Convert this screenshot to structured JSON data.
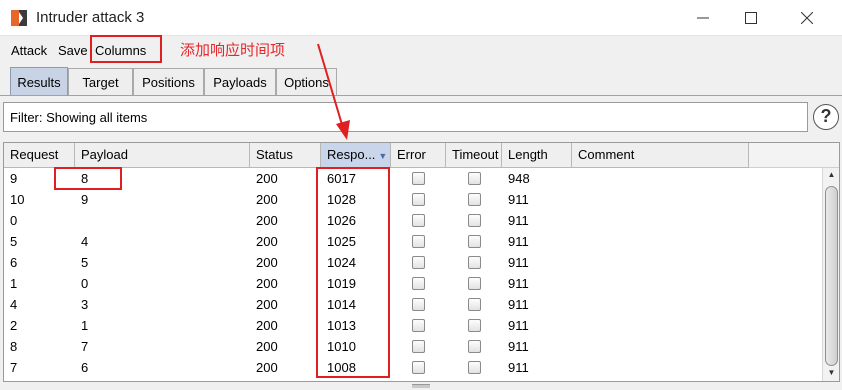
{
  "window": {
    "title": "Intruder attack 3"
  },
  "menu": {
    "attack": "Attack",
    "save": "Save",
    "columns": "Columns"
  },
  "annotation": {
    "note": "添加响应时间项",
    "color": "#e02020"
  },
  "tabs": [
    {
      "label": "Results",
      "active": true
    },
    {
      "label": "Target",
      "active": false
    },
    {
      "label": "Positions",
      "active": false
    },
    {
      "label": "Payloads",
      "active": false
    },
    {
      "label": "Options",
      "active": false
    }
  ],
  "filter": {
    "text": "Filter: Showing all items"
  },
  "table": {
    "columns": [
      "Request",
      "Payload",
      "Status",
      "Respo...",
      "Error",
      "Timeout",
      "Length",
      "Comment"
    ],
    "sorted_column": "Respo...",
    "rows": [
      {
        "request": "9",
        "payload": "8",
        "status": "200",
        "response": "6017",
        "error": false,
        "timeout": false,
        "length": "948",
        "comment": ""
      },
      {
        "request": "10",
        "payload": "9",
        "status": "200",
        "response": "1028",
        "error": false,
        "timeout": false,
        "length": "911",
        "comment": ""
      },
      {
        "request": "0",
        "payload": "",
        "status": "200",
        "response": "1026",
        "error": false,
        "timeout": false,
        "length": "911",
        "comment": ""
      },
      {
        "request": "5",
        "payload": "4",
        "status": "200",
        "response": "1025",
        "error": false,
        "timeout": false,
        "length": "911",
        "comment": ""
      },
      {
        "request": "6",
        "payload": "5",
        "status": "200",
        "response": "1024",
        "error": false,
        "timeout": false,
        "length": "911",
        "comment": ""
      },
      {
        "request": "1",
        "payload": "0",
        "status": "200",
        "response": "1019",
        "error": false,
        "timeout": false,
        "length": "911",
        "comment": ""
      },
      {
        "request": "4",
        "payload": "3",
        "status": "200",
        "response": "1014",
        "error": false,
        "timeout": false,
        "length": "911",
        "comment": ""
      },
      {
        "request": "2",
        "payload": "1",
        "status": "200",
        "response": "1013",
        "error": false,
        "timeout": false,
        "length": "911",
        "comment": ""
      },
      {
        "request": "8",
        "payload": "7",
        "status": "200",
        "response": "1010",
        "error": false,
        "timeout": false,
        "length": "911",
        "comment": ""
      },
      {
        "request": "7",
        "payload": "6",
        "status": "200",
        "response": "1008",
        "error": false,
        "timeout": false,
        "length": "911",
        "comment": ""
      }
    ]
  },
  "icons": {
    "app": "burp-logo-icon",
    "help": "help-icon",
    "minimize": "minimize-icon",
    "maximize": "maximize-icon",
    "close": "close-icon",
    "sort": "sort-descending-icon"
  },
  "colors": {
    "accent_tab": "#c8d3e6",
    "brand": "#e8662b"
  }
}
